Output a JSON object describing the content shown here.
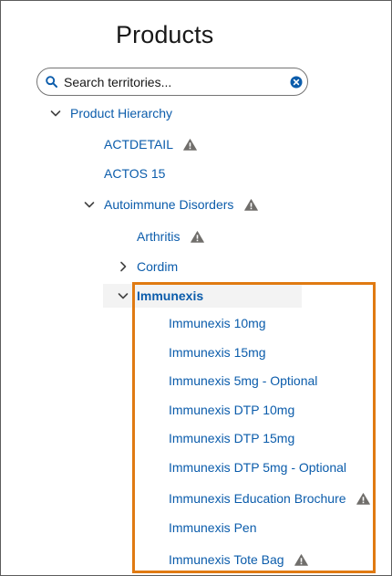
{
  "header": {
    "title": "Products"
  },
  "search": {
    "placeholder": "Search territories..."
  },
  "tree": {
    "root": {
      "label": "Product Hierarchy"
    },
    "items": [
      {
        "label": "ACTDETAIL",
        "warning": true
      },
      {
        "label": "ACTOS 15",
        "warning": false
      },
      {
        "label": "Autoimmune Disorders",
        "warning": true
      },
      {
        "label": "Arthritis",
        "warning": true
      },
      {
        "label": "Cordim",
        "warning": false
      },
      {
        "label": "Immunexis",
        "warning": false
      }
    ],
    "children": [
      {
        "label": "Immunexis 10mg",
        "warning": false
      },
      {
        "label": "Immunexis 15mg",
        "warning": false
      },
      {
        "label": "Immunexis 5mg - Optional",
        "warning": false
      },
      {
        "label": "Immunexis DTP 10mg",
        "warning": false
      },
      {
        "label": "Immunexis DTP 15mg",
        "warning": false
      },
      {
        "label": "Immunexis DTP 5mg - Optional",
        "warning": false
      },
      {
        "label": "Immunexis Education Brochure",
        "warning": true
      },
      {
        "label": "Immunexis Pen",
        "warning": false
      },
      {
        "label": "Immunexis Tote Bag",
        "warning": true
      }
    ]
  },
  "colors": {
    "link": "#0b5cab",
    "highlight": "#e07a12",
    "warning_icon": "#706e6b"
  },
  "icons": {
    "search": "search-icon",
    "clear": "clear-icon",
    "warning": "warning-icon",
    "expand": "chevron-down-icon",
    "collapse": "chevron-right-icon"
  }
}
